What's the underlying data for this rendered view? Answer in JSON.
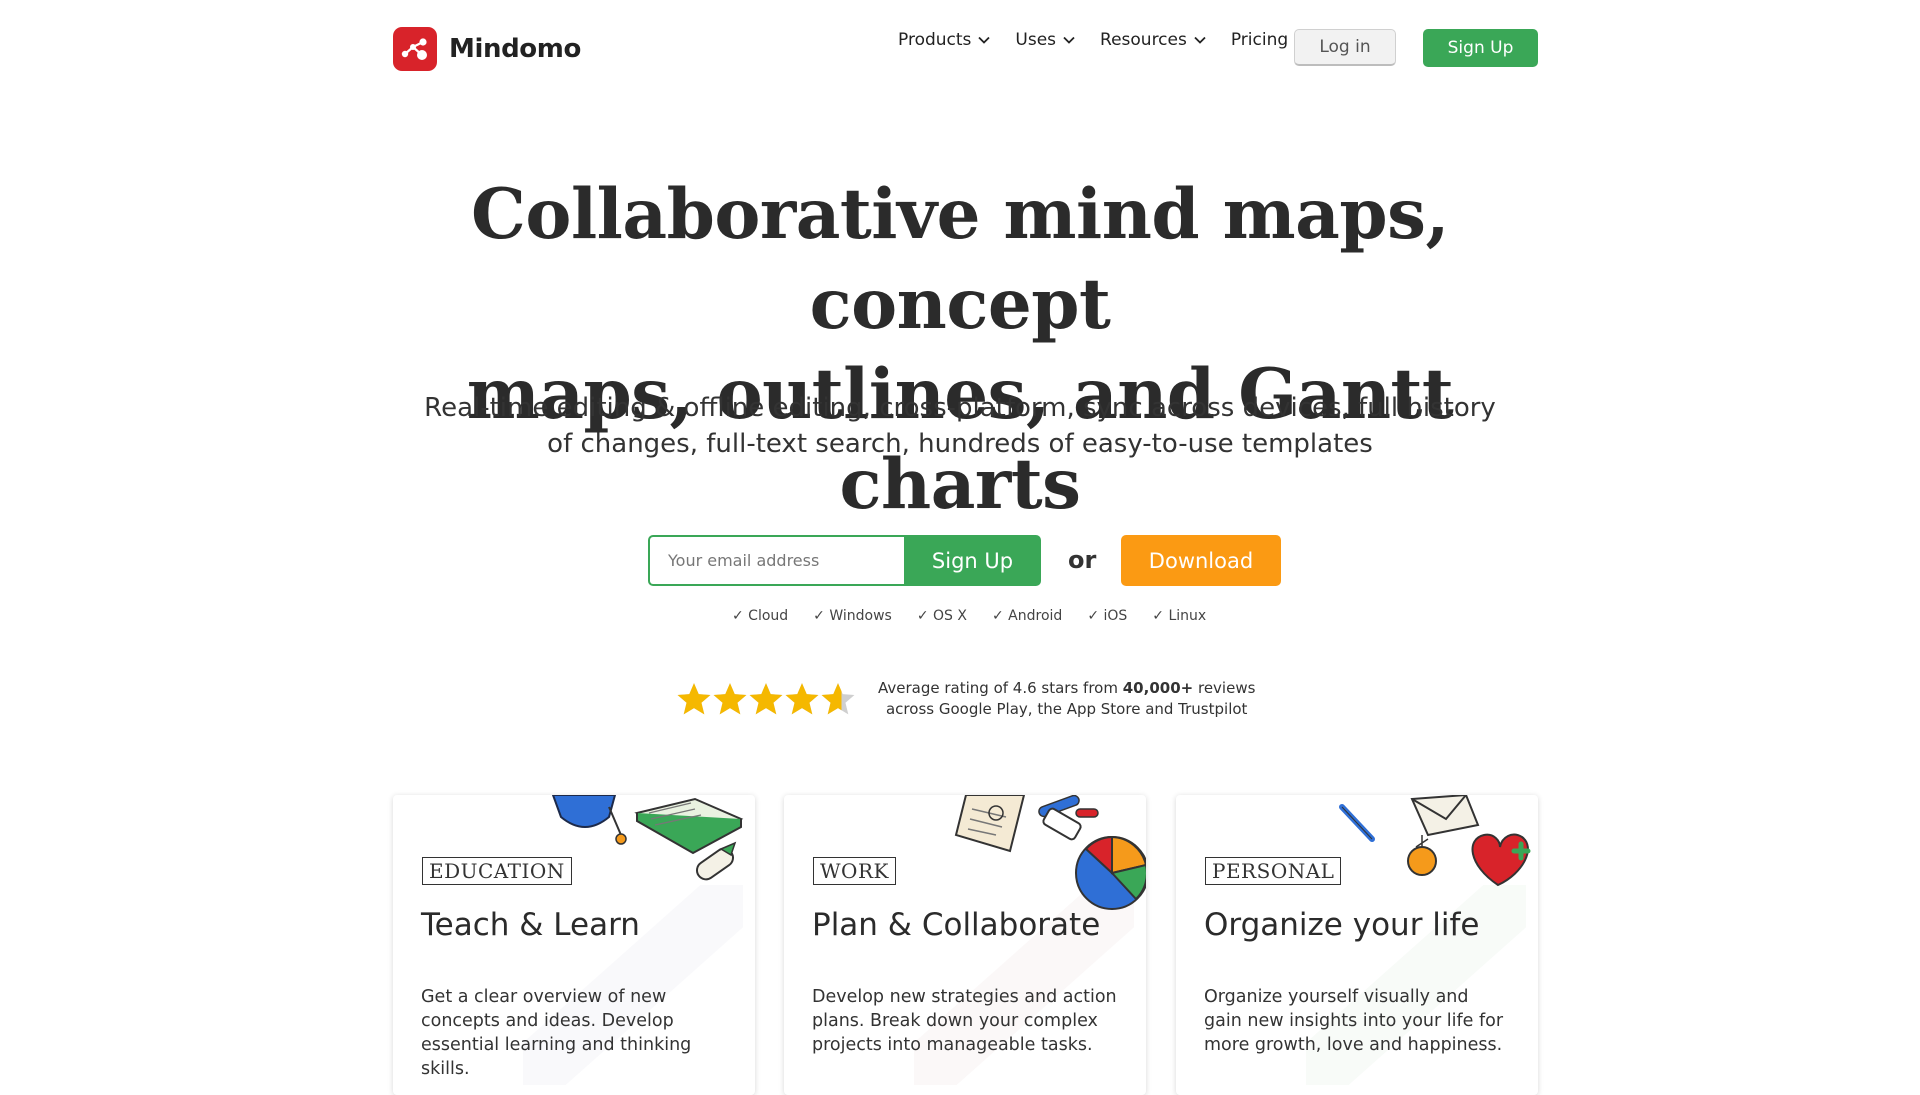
{
  "brand": {
    "name": "Mindomo",
    "color": "#d8232a"
  },
  "nav": {
    "items": [
      {
        "label": "Products",
        "dropdown": true
      },
      {
        "label": "Uses",
        "dropdown": true
      },
      {
        "label": "Resources",
        "dropdown": true
      },
      {
        "label": "Pricing",
        "dropdown": false
      }
    ],
    "login_label": "Log in",
    "signup_label": "Sign Up"
  },
  "hero": {
    "title_line1": "Collaborative mind maps, concept",
    "title_line2": "maps, outlines, and Gantt charts",
    "subtitle": "Real-time editing & offline editing, cross-platform, sync across devices, full history of changes, full-text search, hundreds of easy-to-use templates",
    "email_placeholder": "Your email address",
    "signup_label": "Sign Up",
    "or_label": "or",
    "download_label": "Download",
    "platforms": [
      "✓ Cloud",
      "✓ Windows",
      "✓ OS X",
      "✓ Android",
      "✓ iOS",
      "✓ Linux"
    ]
  },
  "rating": {
    "value": 4.6,
    "max": 5,
    "text_prefix": "Average rating of 4.6 stars from",
    "text_bold": "40,000+",
    "text_suffix": "reviews",
    "line2": "across Google Play, the App Store and Trustpilot",
    "star_color": "#f5b800"
  },
  "cards": [
    {
      "tag": "EDUCATION",
      "title": "Teach & Learn",
      "description": "Get a clear overview of new concepts and ideas. Develop essential learning and thinking skills."
    },
    {
      "tag": "WORK",
      "title": "Plan & Collaborate",
      "description": "Develop new strategies and action plans. Break down your complex projects into manageable tasks."
    },
    {
      "tag": "PERSONAL",
      "title": "Organize your life",
      "description": "Organize yourself visually and gain new insights into your life for more growth, love and happiness."
    }
  ],
  "colors": {
    "green": "#3aa757",
    "orange": "#fb9a13",
    "text": "#333333"
  }
}
